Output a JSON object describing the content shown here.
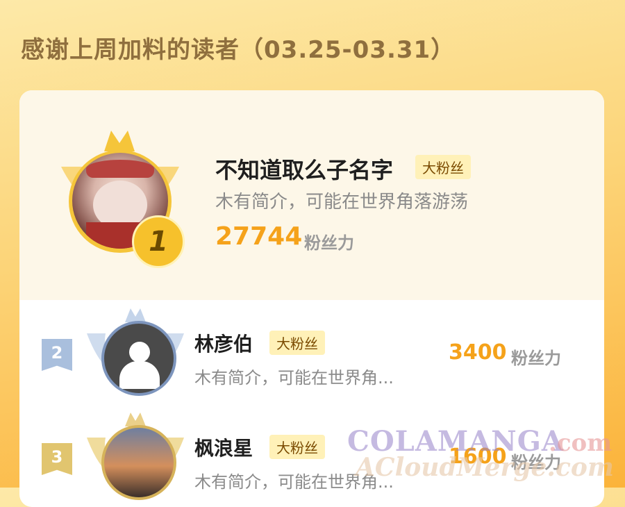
{
  "header": {
    "title": "感谢上周加料的读者（03.25-03.31）"
  },
  "readers": [
    {
      "rank": "1",
      "name": "不知道取么子名字",
      "badge": "大粉丝",
      "bio": "木有简介，可能在世界角落游荡",
      "score": "27744",
      "unit": "粉丝力"
    },
    {
      "rank": "2",
      "name": "林彦伯",
      "badge": "大粉丝",
      "bio": "木有简介，可能在世界角...",
      "score": "3400",
      "unit": "粉丝力"
    },
    {
      "rank": "3",
      "name": "枫浪星",
      "badge": "大粉丝",
      "bio": "木有简介，可能在世界角...",
      "score": "1600",
      "unit": "粉丝力"
    }
  ],
  "watermark": {
    "line1": "COLAMANGA",
    "line1b": ".com",
    "line2": "ACloudMerge.com"
  },
  "colors": {
    "accent": "#f5a21a",
    "badge_bg": "#fff1b8",
    "gold": "#f2b82e",
    "silver": "#9fb6d6",
    "bronze": "#d9b45a"
  }
}
